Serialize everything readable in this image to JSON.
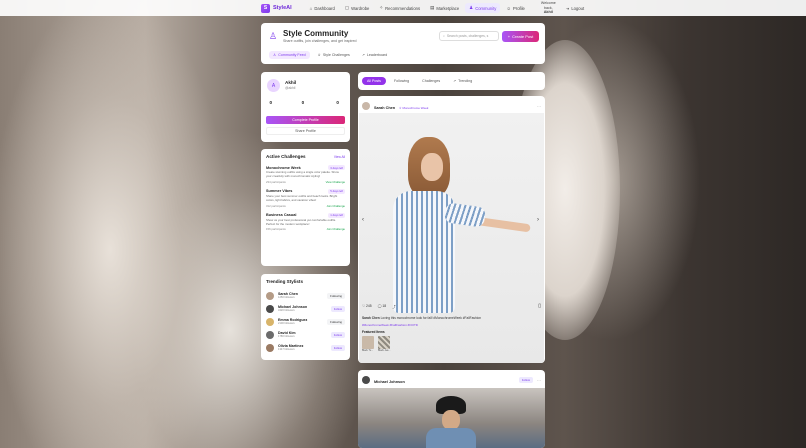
{
  "nav": {
    "brand": "StyleAI",
    "brand_initial": "S",
    "items": [
      {
        "label": "Dashboard",
        "icon": "⌂"
      },
      {
        "label": "Wardrobe",
        "icon": "▢"
      },
      {
        "label": "Recommendations",
        "icon": "✧"
      },
      {
        "label": "Marketplace",
        "icon": "▤"
      },
      {
        "label": "Community",
        "icon": "♟",
        "active": true
      },
      {
        "label": "Profile",
        "icon": "☺"
      }
    ],
    "welcome_line1": "Welcome",
    "welcome_line2": "back,",
    "welcome_user": "Akhil",
    "logout": "Logout"
  },
  "header": {
    "title": "Style Community",
    "subtitle": "Share outfits, join challenges, and get inspired",
    "search_placeholder": "Search posts, challenges, s",
    "create_label": "Create Post",
    "tabs": [
      {
        "label": "Community Feed",
        "active": true
      },
      {
        "label": "Style Challenges"
      },
      {
        "label": "Leaderboard"
      }
    ]
  },
  "profile": {
    "initial": "A",
    "name": "Akhil",
    "handle": "@akhil",
    "stats": [
      {
        "value": "0",
        "label": "Posts"
      },
      {
        "value": "0",
        "label": "Followers"
      },
      {
        "value": "0",
        "label": "Following"
      }
    ],
    "complete_label": "Complete Profile",
    "share_label": "Share Profile"
  },
  "challenges": {
    "title": "Active Challenges",
    "view_all": "View All",
    "items": [
      {
        "name": "Monochrome Week",
        "days": "3 days left",
        "desc": "Create stunning outfits using a single color palette. Show your creativity with monochromatic styling!",
        "participants": "234 participants",
        "join": "View Challenge"
      },
      {
        "name": "Summer Vibes",
        "days": "5 days left",
        "desc": "Share your best summer outfits and beach looks. Bright colors, light fabrics, and vacation vibes!",
        "participants": "312 participants",
        "join": "Join Challenge"
      },
      {
        "name": "Business Casual",
        "days": "1 days left",
        "desc": "Show us your best professional yet comfortable outfits. Perfect for the modern workplace!",
        "participants": "156 participants",
        "join": "Join Challenge"
      }
    ]
  },
  "stylists": {
    "title": "Trending Stylists",
    "items": [
      {
        "name": "Sarah Chen",
        "followers": "1250 followers",
        "action": "Following",
        "color": "#b49b86"
      },
      {
        "name": "Michael Johnson",
        "followers": "3420 followers",
        "action": "Follow",
        "color": "#4a4a4a"
      },
      {
        "name": "Emma Rodriguez",
        "followers": "2100 followers",
        "action": "Following",
        "color": "#d8b46a"
      },
      {
        "name": "David Kim",
        "followers": "1780 followers",
        "action": "Follow",
        "color": "#6b6b6b"
      },
      {
        "name": "Olivia Martinez",
        "followers": "1347 followers",
        "action": "Follow",
        "color": "#9a7a63"
      }
    ]
  },
  "feed_filters": [
    {
      "label": "All Posts",
      "active": true
    },
    {
      "label": "Following"
    },
    {
      "label": "Challenges"
    },
    {
      "label": "Trending"
    }
  ],
  "post1": {
    "user": "Sarah Chen",
    "challenge": "Monochrome Week",
    "date": "15/1/2024 · New York, NY",
    "likes": "245",
    "comments": "18",
    "caption_user": "Sarah Chen",
    "caption": "Loving this monochrome look for fall! #MonochromeWeek #FallFashion",
    "tags": "#MonochromeWeek #FallFashion #OOTD",
    "featured_title": "Featured Items",
    "featured": [
      {
        "label": "Black Tu...",
        "color": "#c9b9a8"
      },
      {
        "label": "Black Jea...",
        "color": "#8e8a80"
      }
    ]
  },
  "post2": {
    "user": "Michael Johnson",
    "date": "14/1/2024",
    "follow": "Follow"
  }
}
